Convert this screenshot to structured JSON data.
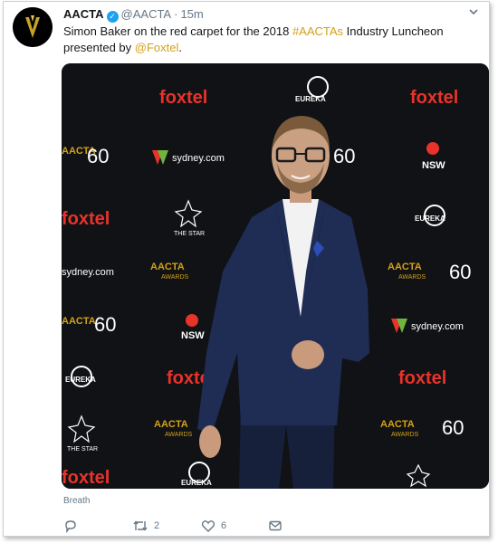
{
  "tweet": {
    "author_name": "AACTA",
    "handle": "@AACTA",
    "separator": "·",
    "time": "15m",
    "text_part1": "Simon Baker on the red carpet for the 2018 ",
    "hashtag": "#AACTAs",
    "text_part2": " Industry Luncheon presented by ",
    "mention": "@Foxtel",
    "text_part3": ".",
    "caption": "Breath"
  },
  "actions": {
    "reply_count": "",
    "retweet_count": "2",
    "like_count": "6"
  },
  "backdrop_logos": {
    "foxtel": "foxtel",
    "eureka": "EUREKA",
    "sydney": "sydney.com",
    "aacta": "AACTA",
    "awards": "AWARDS",
    "nsw": "NSW",
    "the_star": "THE STAR",
    "sixty": "60"
  },
  "colors": {
    "accent": "#d4a017",
    "foxtel_red": "#e8332a",
    "backdrop": "#101215",
    "verified": "#1da1f2",
    "muted": "#657786"
  },
  "icons": {
    "verified": "verified-badge-icon",
    "chevron": "chevron-down-icon",
    "reply": "reply-icon",
    "retweet": "retweet-icon",
    "like": "like-icon",
    "dm": "direct-message-icon"
  }
}
